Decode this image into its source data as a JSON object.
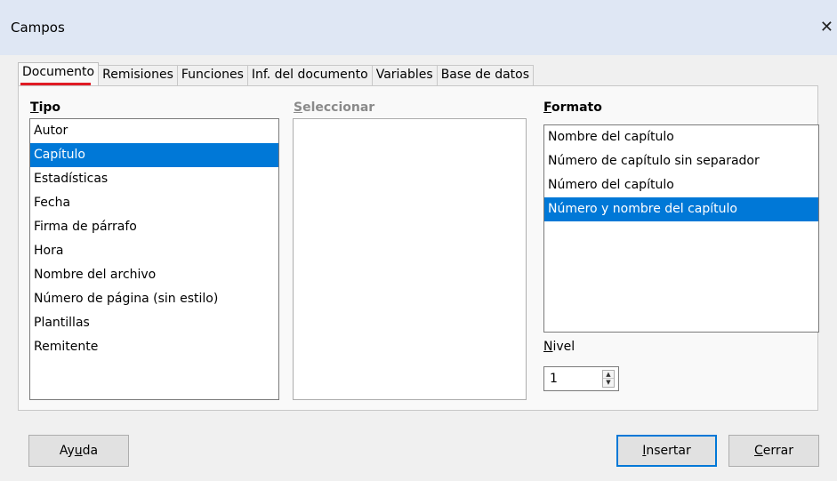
{
  "window": {
    "title": "Campos",
    "close_glyph": "✕"
  },
  "tabs": [
    {
      "label": "Documento"
    },
    {
      "label": "Remisiones"
    },
    {
      "label": "Funciones"
    },
    {
      "label": "Inf. del documento"
    },
    {
      "label": "Variables"
    },
    {
      "label": "Base de datos"
    }
  ],
  "active_tab": "Documento",
  "tipo": {
    "label_first": "T",
    "label_rest": "ipo",
    "items": [
      "Autor",
      "Capítulo",
      "Estadísticas",
      "Fecha",
      "Firma de párrafo",
      "Hora",
      "Nombre del archivo",
      "Número de página (sin estilo)",
      "Plantillas",
      "Remitente"
    ],
    "selected": "Capítulo"
  },
  "seleccionar": {
    "label_first": "S",
    "label_rest": "eleccionar",
    "items": []
  },
  "formato": {
    "label_first": "F",
    "label_rest": "ormato",
    "items": [
      "Nombre del capítulo",
      "Número de capítulo sin separador",
      "Número del capítulo",
      "Número y nombre del capítulo"
    ],
    "selected": "Número y nombre del capítulo"
  },
  "nivel": {
    "label_first": "N",
    "label_rest": "ivel",
    "value": "1"
  },
  "buttons": {
    "help_pre": "Ay",
    "help_u": "u",
    "help_post": "da",
    "insert_u": "I",
    "insert_rest": "nsertar",
    "close_u": "C",
    "close_rest": "errar"
  }
}
